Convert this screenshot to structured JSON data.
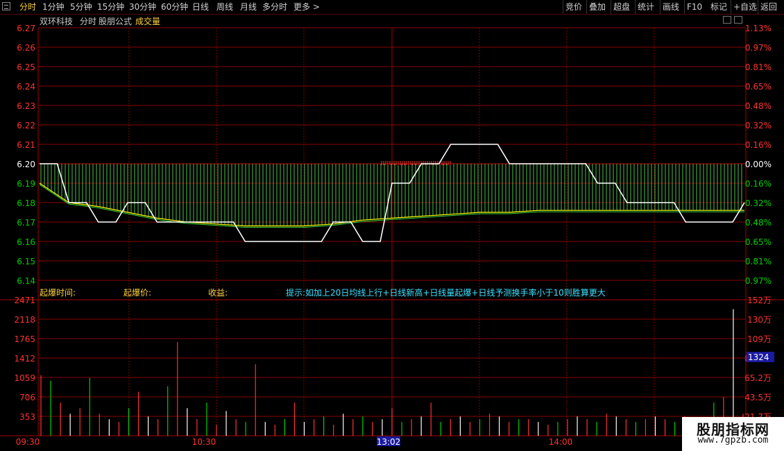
{
  "toolbar": {
    "left_tabs": [
      "分时",
      "1分钟",
      "5分钟",
      "15分钟",
      "30分钟",
      "60分钟",
      "日线",
      "周线",
      "月线",
      "多分时",
      "更多 >"
    ],
    "active_tab": 0,
    "right_buttons": [
      "竞价",
      "叠加",
      "超盘",
      "统计",
      "画线",
      "F10",
      "+自选",
      "返回"
    ],
    "mark_button": "标记"
  },
  "info_bar": {
    "stock_name": "双环科技",
    "mode": "分时",
    "formula": "股朋公式",
    "indicator": "成交量"
  },
  "price_axis": {
    "left_labels": [
      "6.27",
      "6.26",
      "6.25",
      "6.24",
      "6.23",
      "6.22",
      "6.21",
      "6.20",
      "6.19",
      "6.18",
      "6.17",
      "6.16",
      "6.15",
      "6.14"
    ],
    "right_labels": [
      "1.13%",
      "0.97%",
      "0.81%",
      "0.65%",
      "0.48%",
      "0.32%",
      "0.16%",
      "0.00%",
      "0.16%",
      "0.32%",
      "0.48%",
      "0.65%",
      "0.81%",
      "0.97%"
    ]
  },
  "signal_row": {
    "time_label": "起爆时间:",
    "price_label": "起爆价:",
    "profit_label": "收益:",
    "tip": "提示:如加上20日均线上行+日线新高+日线量起爆+日线予测换手率小于10则胜算更大"
  },
  "volume_axis": {
    "left_labels": [
      "2471",
      "2118",
      "1765",
      "1412",
      "1059",
      "706",
      "353"
    ],
    "right_labels": [
      "152万",
      "130万",
      "109万",
      "87.1万",
      "65.2万",
      "43.5万",
      "21.7万"
    ],
    "cursor_value": "1324"
  },
  "time_axis": {
    "labels": [
      "09:30",
      "10:30",
      "11:30",
      "14:00"
    ],
    "cursor_time": "13:02"
  },
  "watermark": {
    "title": "股朋指标网",
    "url": "www.7gpzb.com"
  },
  "colors": {
    "price_line": "#ffffff",
    "avg_line": "#ffff00",
    "up": "#ff3232",
    "down": "#00d000",
    "grid": "#8b0000",
    "tip": "#3ce1ff",
    "label": "#ffd23c",
    "fill": "#4ec24e"
  },
  "chart_data": {
    "type": "line",
    "title": "",
    "xlabel": "",
    "ylabel": "",
    "ylim": [
      6.14,
      6.27
    ],
    "base_price": 6.2,
    "x": [
      0,
      10,
      20,
      30,
      40,
      50,
      60,
      70,
      80,
      90,
      100,
      110,
      120,
      130,
      140,
      150,
      160,
      170,
      180,
      190,
      200,
      210,
      220,
      230,
      240
    ],
    "series": [
      {
        "values": [
          6.2,
          6.18,
          6.17,
          6.18,
          6.17,
          6.17,
          6.17,
          6.16,
          6.16,
          6.16,
          6.17,
          6.16,
          6.19,
          6.2,
          6.21,
          6.21,
          6.2,
          6.2,
          6.2,
          6.19,
          6.18,
          6.18,
          6.17,
          6.17,
          6.18
        ]
      },
      {
        "values": [
          6.19,
          6.18,
          6.178,
          6.175,
          6.172,
          6.17,
          6.169,
          6.168,
          6.168,
          6.168,
          6.169,
          6.171,
          6.172,
          6.173,
          6.174,
          6.175,
          6.175,
          6.176,
          6.176,
          6.176,
          6.176,
          6.176,
          6.176,
          6.176,
          6.176
        ]
      }
    ],
    "volume": {
      "ylim": [
        0,
        2471
      ],
      "values": [
        1100,
        1000,
        600,
        400,
        500,
        1050,
        400,
        300,
        250,
        500,
        800,
        350,
        300,
        900,
        1700,
        500,
        300,
        600,
        200,
        450,
        300,
        250,
        1300,
        250,
        200,
        300,
        600,
        250,
        300,
        350,
        200,
        400,
        300,
        350,
        250,
        300,
        500,
        250,
        300,
        350,
        600,
        250,
        300,
        350,
        250,
        300,
        400,
        350,
        250,
        300,
        300,
        250,
        200,
        250,
        300,
        350,
        300,
        250,
        400,
        350,
        300,
        250,
        300,
        350,
        300,
        250,
        350,
        300,
        250,
        600,
        700,
        2300,
        400
      ],
      "note_label": ""
    }
  }
}
